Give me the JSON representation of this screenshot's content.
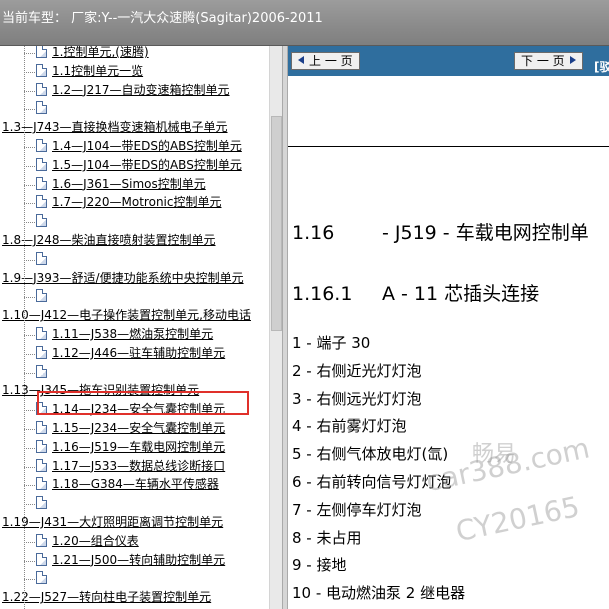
{
  "window": {
    "title": "当前车型： 厂家:Y--一汽大众速腾(Sagitar)2006-2011"
  },
  "tree": {
    "items": [
      {
        "label": "1.控制单元,(速腾)",
        "level": 2
      },
      {
        "label": "1.1控制单元一览",
        "level": 2
      },
      {
        "label": "1.2—J217—自动变速箱控制单元",
        "level": 2
      },
      {
        "label": "",
        "level": 2
      },
      {
        "label": "1.3—J743—直接换档变速箱机械电子单元",
        "level": 1
      },
      {
        "label": "1.4—J104—带EDS的ABS控制单元",
        "level": 2
      },
      {
        "label": "1.5—J104—带EDS的ABS控制单元",
        "level": 2
      },
      {
        "label": "1.6—J361—Simos控制单元",
        "level": 2
      },
      {
        "label": "1.7—J220—Motronic控制单元",
        "level": 2
      },
      {
        "label": "",
        "level": 2
      },
      {
        "label": "1.8—J248—柴油直接喷射装置控制单元",
        "level": 1
      },
      {
        "label": "",
        "level": 2
      },
      {
        "label": "1.9—J393—舒适/便捷功能系统中央控制单元",
        "level": 1
      },
      {
        "label": "",
        "level": 2
      },
      {
        "label": "1.10—J412—电子操作装置控制单元,移动电话",
        "level": 1
      },
      {
        "label": "1.11—J538—燃油泵控制单元",
        "level": 2
      },
      {
        "label": "1.12—J446—驻车辅助控制单元",
        "level": 2
      },
      {
        "label": "",
        "level": 2
      },
      {
        "label": "1.13—J345—拖车识别装置控制单元",
        "level": 1
      },
      {
        "label": "1.14—J234—安全气囊控制单元",
        "level": 2
      },
      {
        "label": "1.15—J234—安全气囊控制单元",
        "level": 2
      },
      {
        "label": "1.16—J519—车载电网控制单元",
        "level": 2
      },
      {
        "label": "1.17—J533—数据总线诊断接口",
        "level": 2
      },
      {
        "label": "1.18—G384—车辆水平传感器",
        "level": 2
      },
      {
        "label": "",
        "level": 2
      },
      {
        "label": "1.19—J431—大灯照明距离调节控制单元",
        "level": 1
      },
      {
        "label": "1.20—组合仪表",
        "level": 2
      },
      {
        "label": "1.21—J500—转向辅助控制单元",
        "level": 2
      },
      {
        "label": "",
        "level": 2
      },
      {
        "label": "1.22—J527—转向柱电子装置控制单元",
        "level": 1
      }
    ]
  },
  "content": {
    "prev_label": "上 一 页",
    "next_label": "下 一 页",
    "extra_label": "[驳",
    "h1_num": "1.16",
    "h1_text": "- J519 - 车载电网控制单",
    "h2_num": "1.16.1",
    "h2_text": "A - 11 芯插头连接",
    "pins": [
      "1 - 端子 30",
      "2 - 右侧近光灯灯泡",
      "3 - 右侧远光灯灯泡",
      "4 - 右前雾灯灯泡",
      "5 - 右侧气体放电灯(氙)",
      "6 - 右前转向信号灯灯泡",
      "7 - 左侧停车灯灯泡",
      "8 - 未占用",
      "9 - 接地",
      "10 - 电动燃油泵 2 继电器"
    ]
  },
  "watermark": {
    "line1": "畅易",
    "line2": "car388.com",
    "line3": "CY20165"
  }
}
